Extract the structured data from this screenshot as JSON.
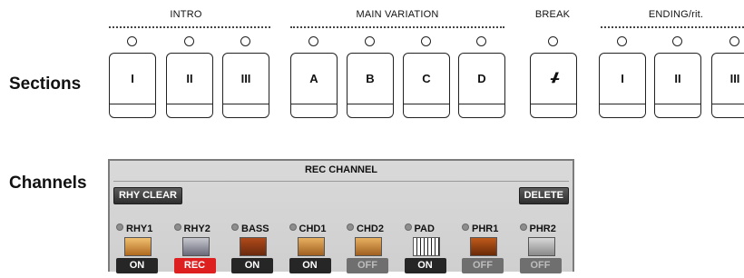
{
  "sections_label": "Sections",
  "channels_label": "Channels",
  "groups": [
    {
      "title": "INTRO"
    },
    {
      "title": "MAIN VARIATION"
    },
    {
      "title": "BREAK"
    },
    {
      "title": "ENDING/rit."
    }
  ],
  "section_buttons": [
    {
      "label": "I",
      "group": "INTRO"
    },
    {
      "label": "II",
      "group": "INTRO"
    },
    {
      "label": "III",
      "group": "INTRO"
    },
    {
      "label": "A",
      "group": "MAIN VARIATION"
    },
    {
      "label": "B",
      "group": "MAIN VARIATION"
    },
    {
      "label": "C",
      "group": "MAIN VARIATION"
    },
    {
      "label": "D",
      "group": "MAIN VARIATION"
    },
    {
      "label": "-//-",
      "group": "BREAK"
    },
    {
      "label": "I",
      "group": "ENDING/rit."
    },
    {
      "label": "II",
      "group": "ENDING/rit."
    },
    {
      "label": "III",
      "group": "ENDING/rit."
    }
  ],
  "panel": {
    "title": "REC CHANNEL",
    "rhy_clear": "RHY CLEAR",
    "delete": "DELETE",
    "channels": [
      {
        "name": "RHY1",
        "state": "ON",
        "icon": "drums-icon"
      },
      {
        "name": "RHY2",
        "state": "REC",
        "icon": "drum-kit-icon"
      },
      {
        "name": "BASS",
        "state": "ON",
        "icon": "bass-guitar-icon"
      },
      {
        "name": "CHD1",
        "state": "ON",
        "icon": "acoustic-guitar-icon"
      },
      {
        "name": "CHD2",
        "state": "OFF",
        "icon": "acoustic-guitar-icon"
      },
      {
        "name": "PAD",
        "state": "ON",
        "icon": "keyboard-icon"
      },
      {
        "name": "PHR1",
        "state": "OFF",
        "icon": "violin-icon"
      },
      {
        "name": "PHR2",
        "state": "OFF",
        "icon": "harp-icon"
      }
    ]
  },
  "colors": {
    "on": "#262626",
    "rec": "#dd1f1f",
    "off": "#6f6f6f",
    "panel_bg": "#d4d4d4"
  }
}
